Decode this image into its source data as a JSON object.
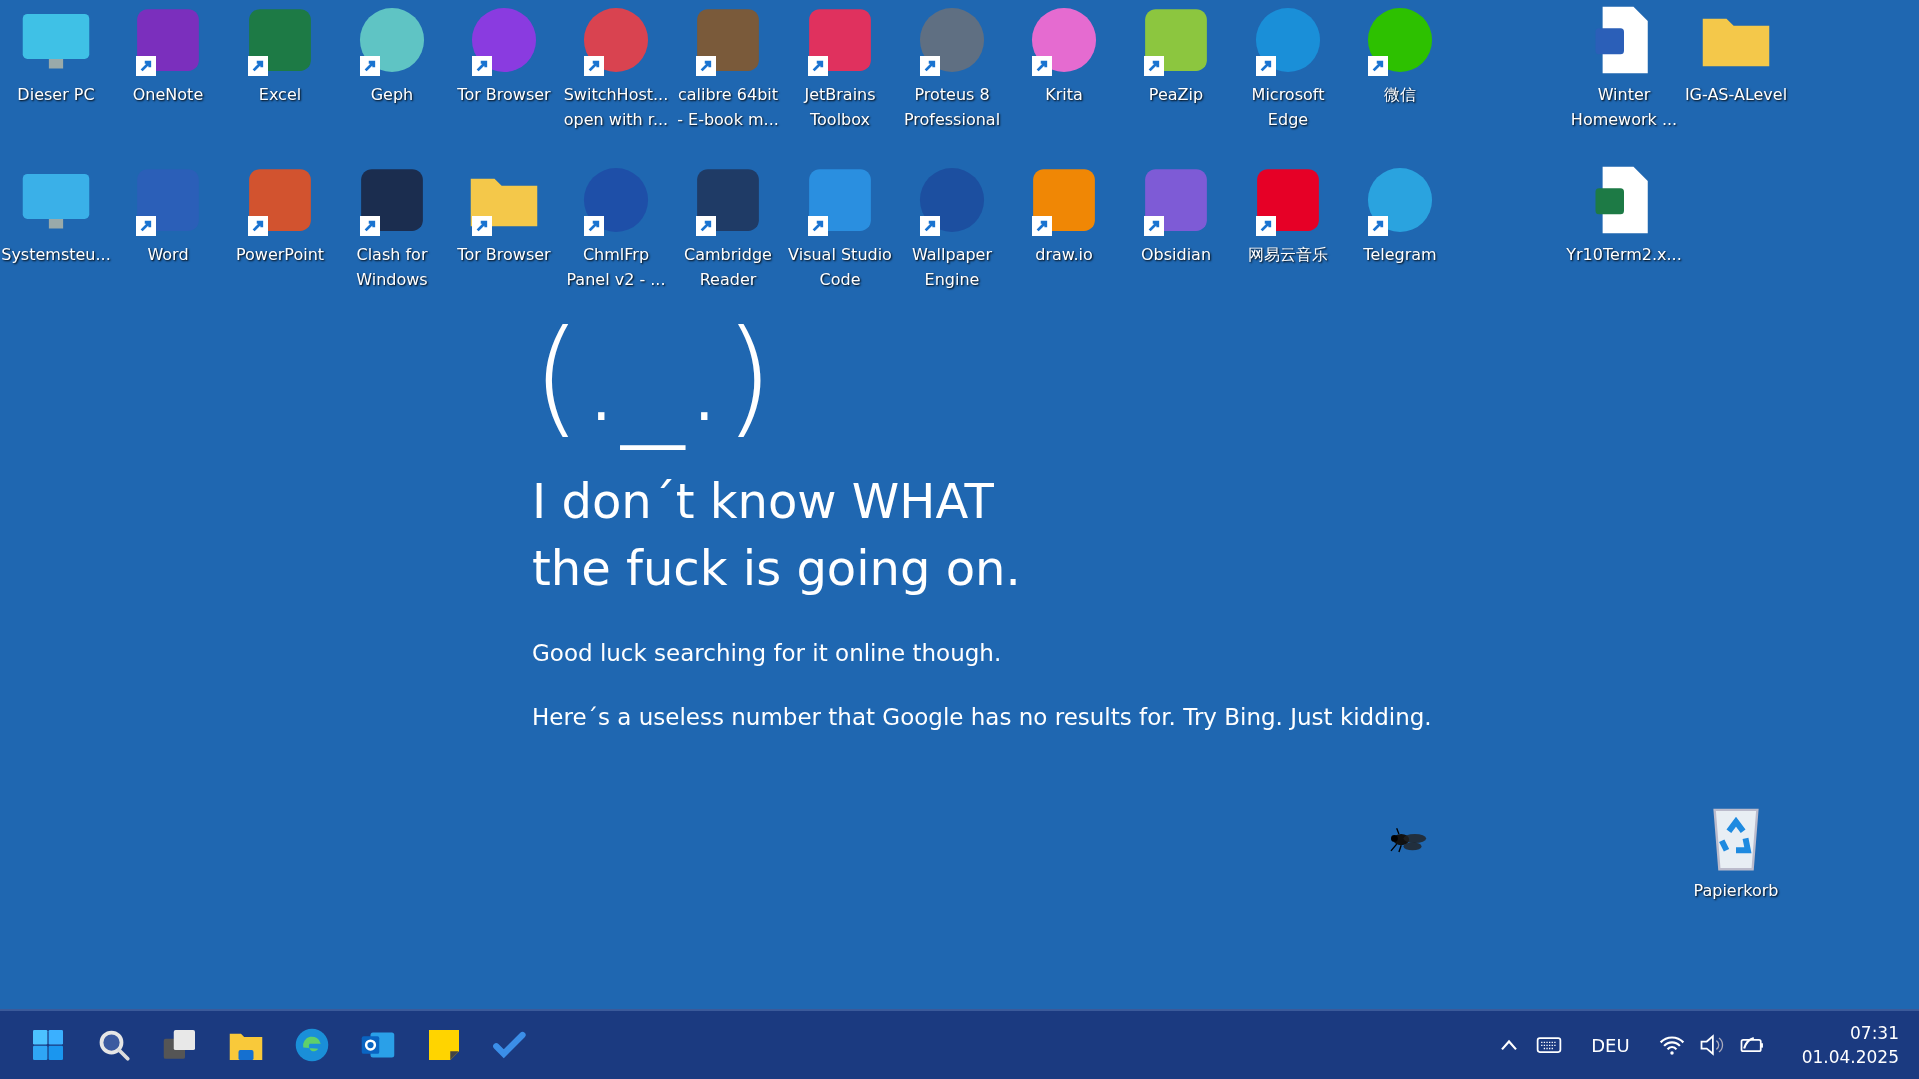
{
  "desktop": {
    "left_icons": [
      {
        "label": [
          "Dieser PC"
        ],
        "kind": "system",
        "color": "#3fc1e6",
        "shortcut": false
      },
      {
        "label": [
          "OneNote"
        ],
        "kind": "app",
        "color": "#7b2fbd",
        "shortcut": true
      },
      {
        "label": [
          "Excel"
        ],
        "kind": "app",
        "color": "#1d7a45",
        "shortcut": true
      },
      {
        "label": [
          "Geph"
        ],
        "kind": "round",
        "color": "#5fc4c4",
        "shortcut": true
      },
      {
        "label": [
          "Tor Browser"
        ],
        "kind": "round",
        "color": "#8a3be0",
        "shortcut": true
      },
      {
        "label": [
          "SwitchHost...",
          "open with r..."
        ],
        "kind": "round",
        "color": "#d94350",
        "shortcut": true
      },
      {
        "label": [
          "calibre 64bit",
          "- E-book m..."
        ],
        "kind": "app",
        "color": "#7a5a3a",
        "shortcut": true
      },
      {
        "label": [
          "JetBrains",
          "Toolbox"
        ],
        "kind": "app",
        "color": "#e0315e",
        "shortcut": true
      },
      {
        "label": [
          "Proteus 8",
          "Professional"
        ],
        "kind": "round",
        "color": "#5f6f82",
        "shortcut": true
      },
      {
        "label": [
          "Krita"
        ],
        "kind": "round",
        "color": "#e56bd0",
        "shortcut": true
      },
      {
        "label": [
          "PeaZip"
        ],
        "kind": "app",
        "color": "#8cc63f",
        "shortcut": true
      },
      {
        "label": [
          "Microsoft",
          "Edge"
        ],
        "kind": "round",
        "color": "#1a8fd8",
        "shortcut": true
      },
      {
        "label": [
          "微信"
        ],
        "kind": "round",
        "color": "#2dc100",
        "shortcut": true
      },
      {
        "label": [
          "Systemsteu..."
        ],
        "kind": "system",
        "color": "#3ab0e8",
        "shortcut": false
      },
      {
        "label": [
          "Word"
        ],
        "kind": "app",
        "color": "#2b5fb8",
        "shortcut": true
      },
      {
        "label": [
          "PowerPoint"
        ],
        "kind": "app",
        "color": "#d2532f",
        "shortcut": true
      },
      {
        "label": [
          "Clash for",
          "Windows"
        ],
        "kind": "app",
        "color": "#1b2d4f",
        "shortcut": true
      },
      {
        "label": [
          "Tor Browser"
        ],
        "kind": "folder",
        "color": "#f4c84a",
        "shortcut": true
      },
      {
        "label": [
          "ChmlFrp",
          "Panel v2 - ..."
        ],
        "kind": "round",
        "color": "#1e4fa8",
        "shortcut": true
      },
      {
        "label": [
          "Cambridge",
          "Reader"
        ],
        "kind": "app",
        "color": "#1f3b66",
        "shortcut": true
      },
      {
        "label": [
          "Visual Studio",
          "Code"
        ],
        "kind": "app",
        "color": "#2a8fe0",
        "shortcut": true
      },
      {
        "label": [
          "Wallpaper",
          "Engine"
        ],
        "kind": "round",
        "color": "#1c4fa0",
        "shortcut": true
      },
      {
        "label": [
          "draw.io"
        ],
        "kind": "app",
        "color": "#f08705",
        "shortcut": true
      },
      {
        "label": [
          "Obsidian"
        ],
        "kind": "app",
        "color": "#7e5bd6",
        "shortcut": true
      },
      {
        "label": [
          "网易云音乐"
        ],
        "kind": "app",
        "color": "#e60026",
        "shortcut": true
      },
      {
        "label": [
          "Telegram"
        ],
        "kind": "round",
        "color": "#2aa3df",
        "shortcut": true
      }
    ],
    "right_icons": [
      {
        "label": [
          "Winter",
          "Homework ..."
        ],
        "kind": "file",
        "color": "#2b5fb8",
        "shortcut": false
      },
      {
        "label": [
          "IG-AS-ALevel"
        ],
        "kind": "folder",
        "color": "#f4c84a",
        "shortcut": false
      },
      {
        "label": [
          "Yr10Term2.x..."
        ],
        "kind": "file",
        "color": "#1d7a45",
        "shortcut": false
      }
    ],
    "recycle_bin": {
      "label": [
        "Papierkorb"
      ]
    }
  },
  "message": {
    "face": "(._.)",
    "headline": [
      "I don´t know WHAT",
      "the fuck is going on."
    ],
    "paragraphs": [
      "Good luck searching for it online though.",
      "Here´s a useless number that Google has no results for. Try Bing. Just kidding."
    ]
  },
  "taskbar": {
    "language": "DEU",
    "time": "07:31",
    "date": "01.04.2025"
  }
}
